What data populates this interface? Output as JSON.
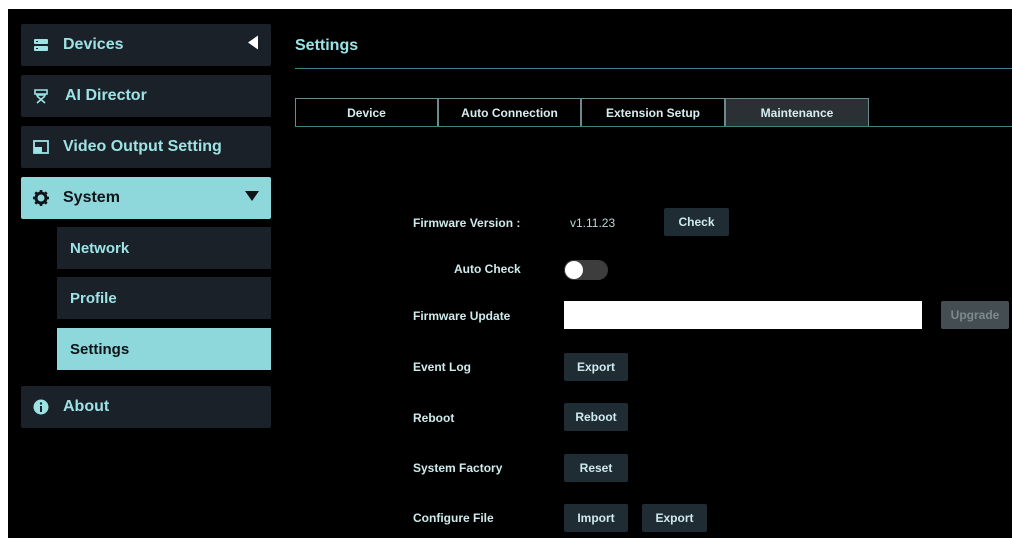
{
  "sidebar": {
    "items": [
      {
        "label": "Devices",
        "icon": "server-icon"
      },
      {
        "label": "AI Director",
        "icon": "director-chair-icon"
      },
      {
        "label": "Video Output Setting",
        "icon": "monitor-icon"
      },
      {
        "label": "System",
        "icon": "gear-icon"
      },
      {
        "label": "About",
        "icon": "info-icon"
      }
    ],
    "system_sub": [
      {
        "label": "Network"
      },
      {
        "label": "Profile"
      },
      {
        "label": "Settings"
      }
    ],
    "active_sub": "Settings"
  },
  "main": {
    "title": "Settings",
    "tabs": [
      {
        "label": "Device"
      },
      {
        "label": "Auto Connection"
      },
      {
        "label": "Extension Setup"
      },
      {
        "label": "Maintenance"
      }
    ],
    "active_tab": "Maintenance",
    "maintenance": {
      "firmware_version_label": "Firmware Version :",
      "firmware_version_value": "v1.11.23",
      "check_label": "Check",
      "auto_check_label": "Auto Check",
      "auto_check_on": false,
      "firmware_update_label": "Firmware Update",
      "firmware_update_value": "",
      "upgrade_label": "Upgrade",
      "event_log_label": "Event Log",
      "event_log_button": "Export",
      "reboot_label": "Reboot",
      "reboot_button": "Reboot",
      "system_factory_label": "System Factory",
      "reset_button": "Reset",
      "configure_file_label": "Configure File",
      "import_button": "Import",
      "export_button": "Export"
    }
  },
  "colors": {
    "accent": "#8ed8dc",
    "text_cyan": "#9ce3e6",
    "nav_bg": "#1b2128",
    "background": "#000000"
  }
}
